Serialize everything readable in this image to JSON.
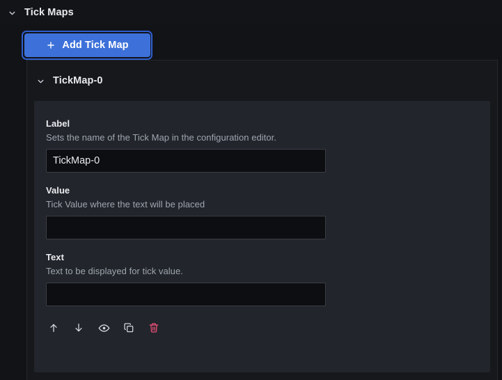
{
  "section": {
    "title": "Tick Maps",
    "collapse_icon": "chevron-down-icon",
    "expanded": true
  },
  "add_button": {
    "label": "Add Tick Map",
    "icon": "plus-icon",
    "focused": true,
    "background_color": "#3d71d9",
    "focus_ring_color": "#2f5fd0",
    "text_color": "#ffffff"
  },
  "group": {
    "title": "TickMap-0",
    "collapse_icon": "chevron-down-icon",
    "expanded": true
  },
  "fields": [
    {
      "label": "Label",
      "description": "Sets the name of the Tick Map in the configuration editor.",
      "value": "TickMap-0",
      "placeholder": ""
    },
    {
      "label": "Value",
      "description": "Tick Value where the text will be placed",
      "value": "",
      "placeholder": ""
    },
    {
      "label": "Text",
      "description": "Text to be displayed for tick value.",
      "value": "",
      "placeholder": ""
    }
  ],
  "actions": [
    {
      "name": "move-up-icon",
      "title": "Move up"
    },
    {
      "name": "move-down-icon",
      "title": "Move down"
    },
    {
      "name": "eye-icon",
      "title": "Toggle visibility"
    },
    {
      "name": "copy-icon",
      "title": "Duplicate"
    },
    {
      "name": "trash-icon",
      "title": "Delete",
      "color": "#f0507a"
    }
  ],
  "theme": {
    "page_background": "#121317",
    "panel_background": "#16181c",
    "card_background": "#22252b",
    "input_background": "#0d0e11",
    "input_border": "#3b3e45",
    "text_primary": "#e9ebef",
    "text_secondary": "#9fa6b0"
  }
}
